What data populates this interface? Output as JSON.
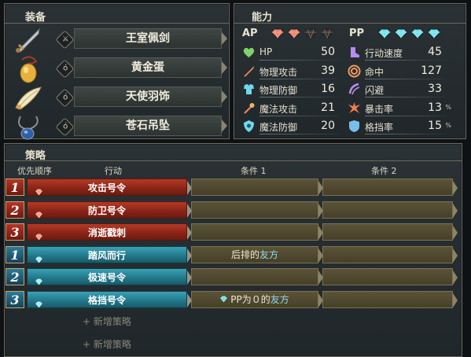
{
  "equipment": {
    "title": "装备",
    "items": [
      {
        "slot_glyph": "⚔",
        "name": "王室佩剑"
      },
      {
        "slot_glyph": "ó",
        "name": "黄金蛋"
      },
      {
        "slot_glyph": "ó",
        "name": "天使羽饰"
      },
      {
        "slot_glyph": "ó",
        "name": "苍石吊坠"
      }
    ]
  },
  "abilities": {
    "title": "能力",
    "ap_label": "AP",
    "pp_label": "PP",
    "ap_gems_filled": 2,
    "ap_gems_total": 4,
    "pp_gems_filled": 4,
    "pp_gems_total": 4,
    "left_stats": [
      {
        "icon": "heart-icon",
        "label": "HP",
        "value": "50"
      },
      {
        "icon": "sword-icon",
        "label": "物理攻击",
        "value": "39"
      },
      {
        "icon": "armor-icon",
        "label": "物理防御",
        "value": "16"
      },
      {
        "icon": "wand-icon",
        "label": "魔法攻击",
        "value": "21"
      },
      {
        "icon": "magic-shield-icon",
        "label": "魔法防御",
        "value": "20"
      }
    ],
    "right_stats": [
      {
        "icon": "boot-icon",
        "label": "行动速度",
        "value": "45",
        "unit": ""
      },
      {
        "icon": "target-icon",
        "label": "命中",
        "value": "127",
        "unit": ""
      },
      {
        "icon": "evade-icon",
        "label": "闪避",
        "value": "33",
        "unit": ""
      },
      {
        "icon": "critical-icon",
        "label": "暴击率",
        "value": "13",
        "unit": "%"
      },
      {
        "icon": "block-icon",
        "label": "格挡率",
        "value": "15",
        "unit": "%"
      }
    ]
  },
  "tactics": {
    "title": "策略",
    "headers": {
      "priority": "优先顺序",
      "action": "行动",
      "cond1": "条件 1",
      "cond2": "条件 2"
    },
    "rows": [
      {
        "priority": "1",
        "type": "red",
        "action": "攻击号令",
        "cond1_pre": "",
        "cond1_hl": "",
        "cond1_gem": false,
        "cond2": ""
      },
      {
        "priority": "2",
        "type": "red",
        "action": "防卫号令",
        "cond1_pre": "",
        "cond1_hl": "",
        "cond1_gem": false,
        "cond2": ""
      },
      {
        "priority": "3",
        "type": "red",
        "action": "消逝戳刺",
        "cond1_pre": "",
        "cond1_hl": "",
        "cond1_gem": false,
        "cond2": ""
      },
      {
        "priority": "1",
        "type": "blue",
        "action": "踏风而行",
        "cond1_pre": "后排的",
        "cond1_hl": "友方",
        "cond1_gem": false,
        "cond2": ""
      },
      {
        "priority": "2",
        "type": "blue",
        "action": "极速号令",
        "cond1_pre": "",
        "cond1_hl": "",
        "cond1_gem": false,
        "cond2": ""
      },
      {
        "priority": "3",
        "type": "blue",
        "action": "格挡号令",
        "cond1_pre": "PP为０的",
        "cond1_hl": "友方",
        "cond1_gem": true,
        "cond2": ""
      }
    ],
    "add_label": "+ 新增策略",
    "add_rows": 2
  },
  "colors": {
    "hp": "#7ed36a",
    "ap_gem": "#e8846a",
    "pp_gem": "#6fe3ef",
    "red_action": "#9a2a1a",
    "blue_action": "#2a8496",
    "condition": "#52492f"
  }
}
